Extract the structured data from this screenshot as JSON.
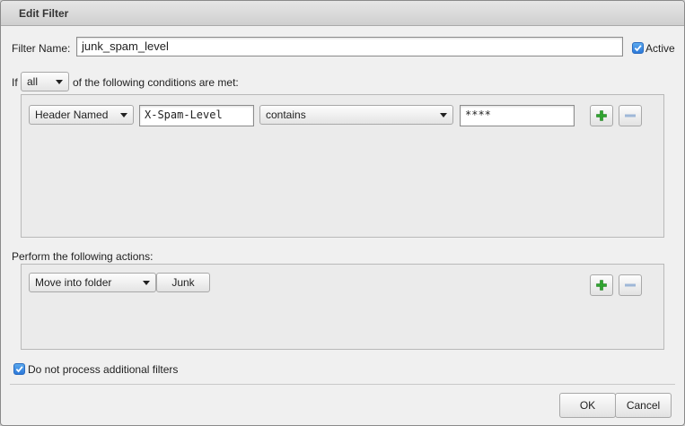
{
  "dialog": {
    "title": "Edit Filter"
  },
  "filter_name": {
    "label": "Filter Name:",
    "value": "junk_spam_level"
  },
  "active": {
    "label": "Active",
    "checked": true
  },
  "conditions": {
    "prefix": "If",
    "match_select": "all",
    "suffix": "of the following conditions are met:",
    "rule": {
      "field_select": "Header Named",
      "header_value": "X-Spam-Level",
      "operator_select": "contains",
      "match_value": "****"
    }
  },
  "actions": {
    "heading": "Perform the following actions:",
    "rule": {
      "action_select": "Move into folder",
      "folder_button": "Junk"
    }
  },
  "stop_processing": {
    "label": "Do not process additional filters",
    "checked": true
  },
  "footer": {
    "ok_label": "OK",
    "cancel_label": "Cancel"
  },
  "colors": {
    "accent": "#2d79d9",
    "plus_green": "#2fa52f",
    "minus_blue": "#9fb8d8"
  },
  "icons": {
    "plus": "plus-icon",
    "minus": "minus-icon",
    "check": "checkmark-icon"
  }
}
